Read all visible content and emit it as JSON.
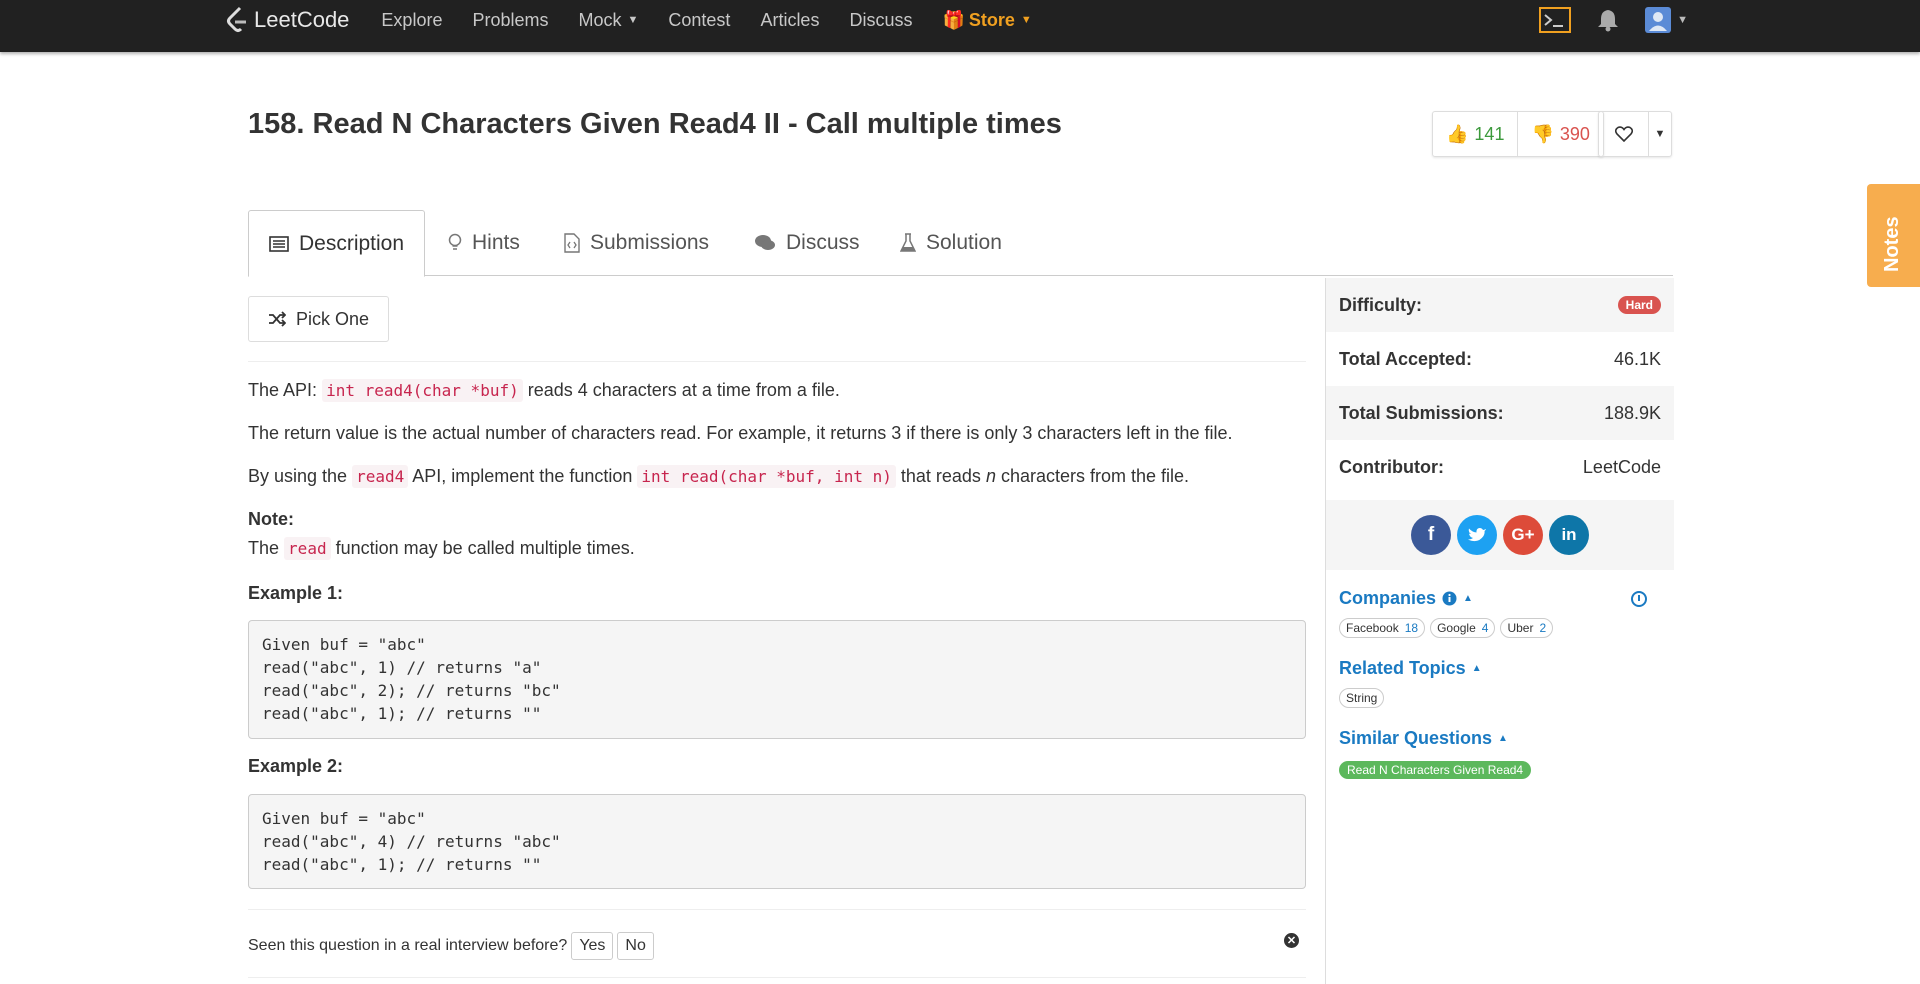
{
  "nav": {
    "logo": "LeetCode",
    "links": [
      "Explore",
      "Problems",
      "Mock",
      "Contest",
      "Articles",
      "Discuss"
    ],
    "store": "Store"
  },
  "problem": {
    "title": "158. Read N Characters Given Read4 II - Call multiple times",
    "likes": "141",
    "dislikes": "390"
  },
  "notes_label": "Notes",
  "tabs": [
    "Description",
    "Hints",
    "Submissions",
    "Discuss",
    "Solution"
  ],
  "pick_one": "Pick One",
  "content": {
    "p1_a": "The API:",
    "p1_code": "int read4(char *buf)",
    "p1_b": "reads 4 characters at a time from a file.",
    "p2": "The return value is the actual number of characters read. For example, it returns 3 if there is only 3 characters left in the file.",
    "p3_a": "By using the",
    "p3_code1": "read4",
    "p3_b": "API, implement the function",
    "p3_code2": "int read(char *buf, int n)",
    "p3_c": "that reads",
    "p3_n": "n",
    "p3_d": "characters from the file.",
    "note_label": "Note:",
    "note_a": "The",
    "note_code": "read",
    "note_b": "function may be called multiple times.",
    "ex1_label": "Example 1:",
    "ex1_lines": [
      "Given buf = \"abc\"",
      "read(\"abc\", 1) // returns \"a\"",
      "read(\"abc\", 2); // returns \"bc\"",
      "read(\"abc\", 1); // returns \"\""
    ],
    "ex2_label": "Example 2:",
    "ex2_lines": [
      "Given buf = \"abc\"",
      "read(\"abc\", 4) // returns \"abc\"",
      "read(\"abc\", 1); // returns \"\""
    ]
  },
  "interview": {
    "question": "Seen this question in a real interview before?",
    "yes": "Yes",
    "no": "No"
  },
  "sidebar": {
    "difficulty_label": "Difficulty:",
    "difficulty": "Hard",
    "accepted_label": "Total Accepted:",
    "accepted": "46.1K",
    "submissions_label": "Total Submissions:",
    "submissions": "188.9K",
    "contributor_label": "Contributor:",
    "contributor": "LeetCode",
    "companies_title": "Companies",
    "companies": [
      {
        "name": "Facebook",
        "count": "18"
      },
      {
        "name": "Google",
        "count": "4"
      },
      {
        "name": "Uber",
        "count": "2"
      }
    ],
    "topics_title": "Related Topics",
    "topics": [
      "String"
    ],
    "similar_title": "Similar Questions",
    "similar": [
      "Read N Characters Given Read4"
    ]
  },
  "colors": {
    "navbar": "#212121",
    "link_blue": "#1a7ac2",
    "hard": "#d9534f",
    "easy_green": "#5cb85c",
    "store_orange": "#f0a020"
  }
}
